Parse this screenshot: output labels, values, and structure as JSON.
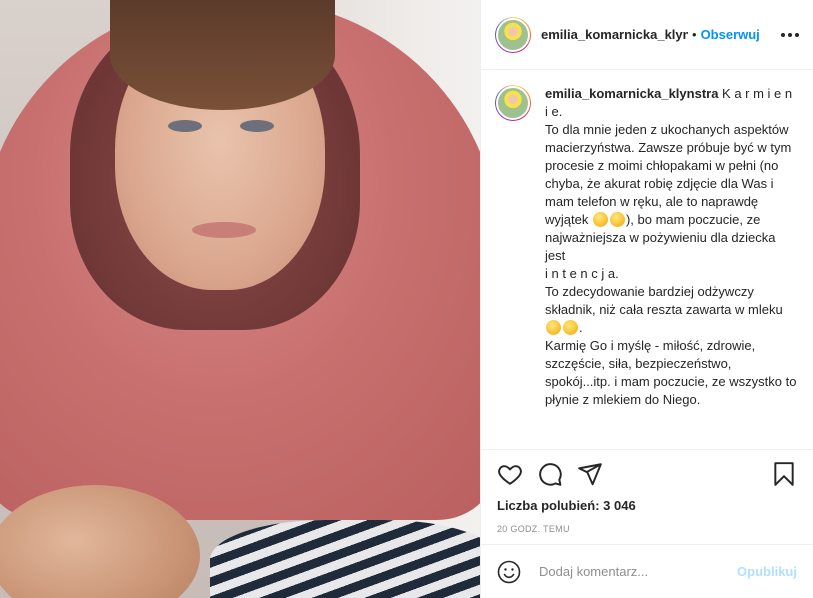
{
  "photo": {
    "alt": ""
  },
  "header": {
    "username": "emilia_komarnicka_klynstra",
    "dot": "•",
    "follow_label": "Obserwuj",
    "more_icon": "more-horizontal-icon"
  },
  "caption": {
    "username": "emilia_komarnicka_klynstra",
    "parts": {
      "p1": " K a r m i e n i e.\nTo dla mnie jeden z ukochanych aspektów macierzyństwa. Zawsze próbuje być w tym procesie z moimi chłopakami w pełni (no chyba, że akurat robię zdjęcie dla Was i mam telefon w ręku, ale to naprawdę wyjątek ",
      "p2": "), bo mam poczucie, ze najważniejsza w pożywieniu dla dziecka jest\ni n t e n c j a.\nTo zdecydowanie bardziej odżywczy składnik, niż cała reszta zawarta w mleku ",
      "p3": ".\nKarmię Go i myślę - miłość, zdrowie, szczęście, siła, bezpieczeństwo, spokój...itp. i mam poczucie, ze wszystko to płynie z mlekiem do Niego."
    },
    "emoji_names": [
      "zany-face-emoji",
      "smiling-face-emoji"
    ]
  },
  "actions": {
    "like_icon": "heart-icon",
    "comment_icon": "comment-icon",
    "share_icon": "share-icon",
    "save_icon": "bookmark-icon"
  },
  "likes_text": "Liczba polubień: 3 046",
  "time_text": "20 GODZ. TEMU",
  "comment_box": {
    "placeholder": "Dodaj komentarz...",
    "publish_label": "Opublikuj",
    "emoji_icon": "smiley-icon"
  },
  "colors": {
    "accent": "#0095f6",
    "publish_disabled": "#b2dffc",
    "muted": "#8e8e8e",
    "text": "#262626"
  }
}
